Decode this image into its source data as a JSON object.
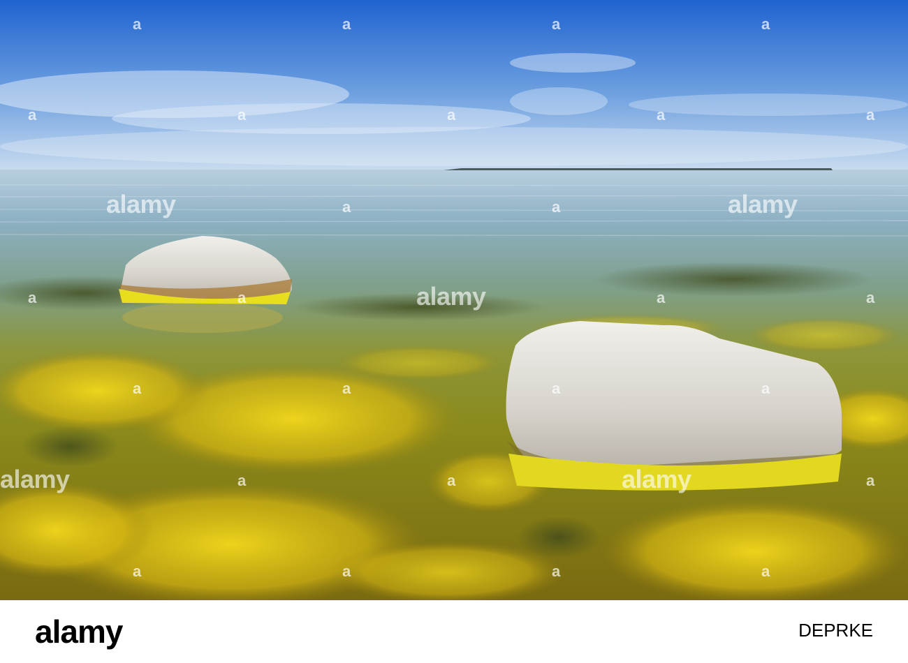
{
  "watermark": {
    "brand": "alamy",
    "mark": "a"
  },
  "footer": {
    "logo_text": "alamy",
    "image_code": "DEPRKE"
  },
  "scene": {
    "sky_color": "#2a6fd6",
    "water_color": "#6f9aa8",
    "seaweed_color": "#d8c21a",
    "rock_color": "#d9d6d1"
  }
}
